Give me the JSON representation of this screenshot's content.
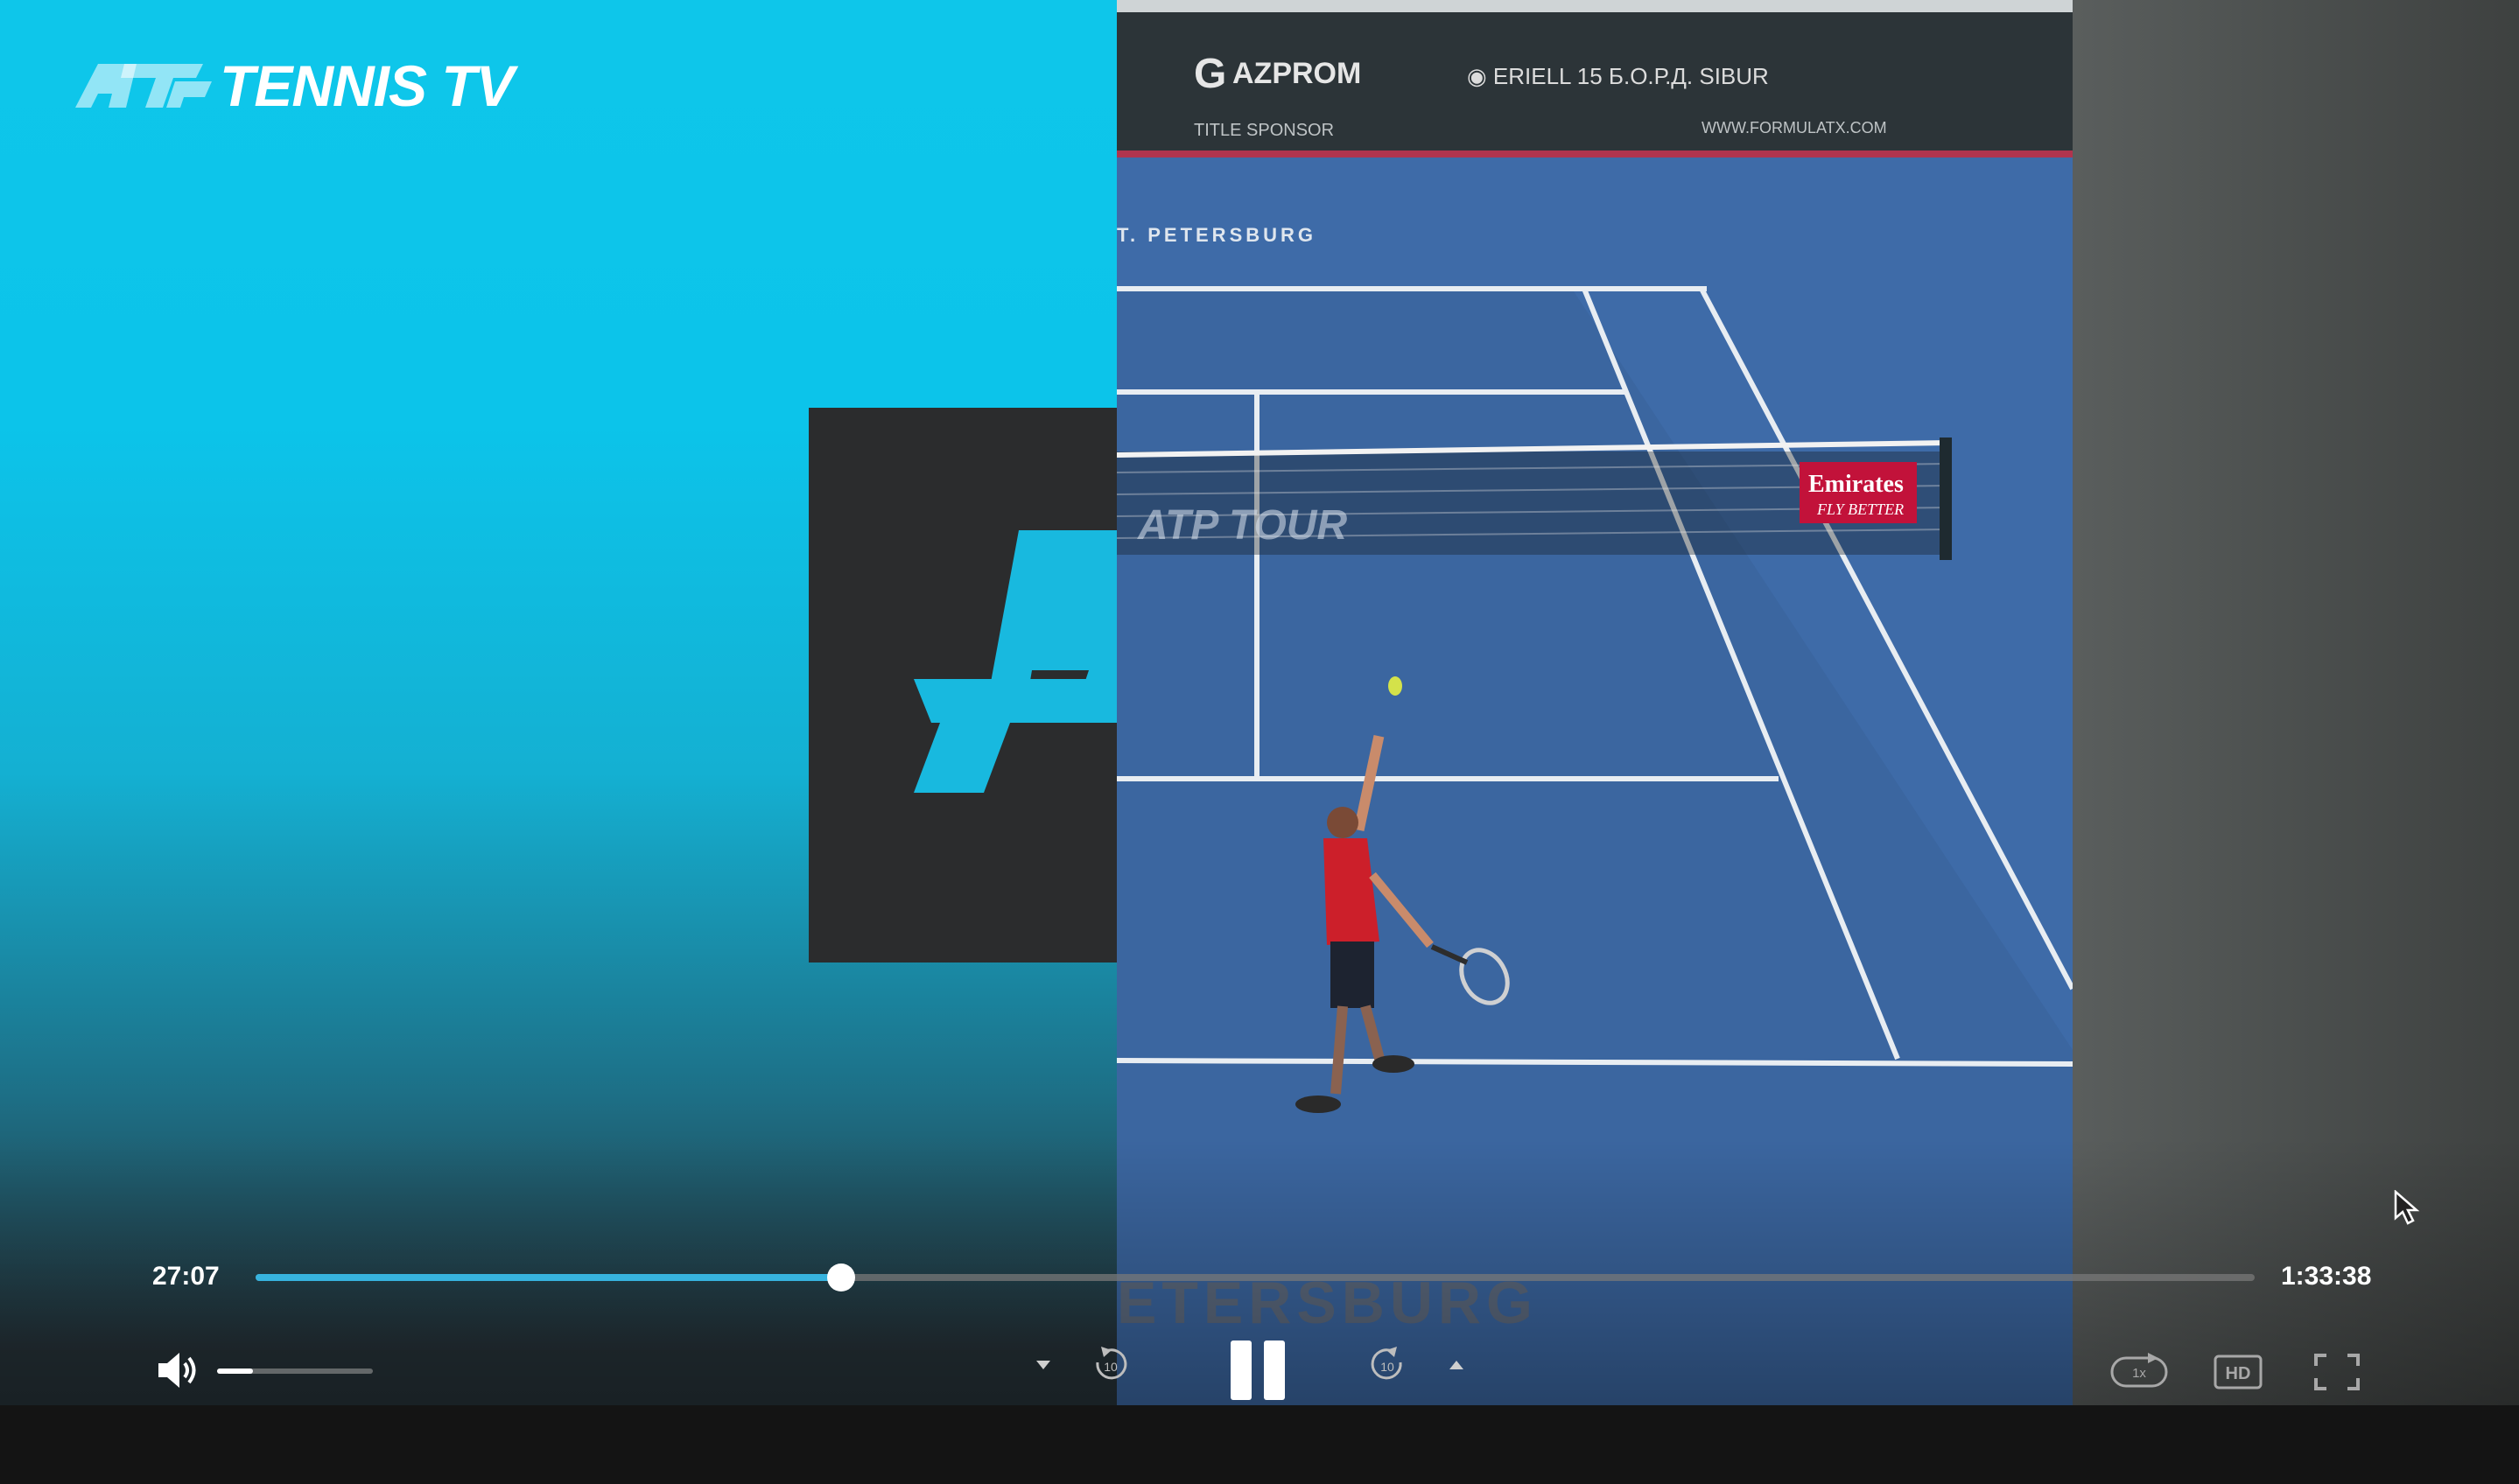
{
  "brand": {
    "name": "TENNIS TV",
    "logo_icon": "atp-logo-icon"
  },
  "video": {
    "description_icons": [
      "court-view",
      "promo-card"
    ]
  },
  "playback": {
    "current_time": "27:07",
    "total_time": "1:33:38",
    "progress_fraction": 0.293,
    "volume_fraction": 0.23,
    "speed_label": "1x",
    "hd_label": "HD",
    "rewind_seconds": "10",
    "forward_seconds": "10"
  },
  "colors": {
    "accent": "#37b3de",
    "brand_cyan": "#0ec6ea"
  }
}
